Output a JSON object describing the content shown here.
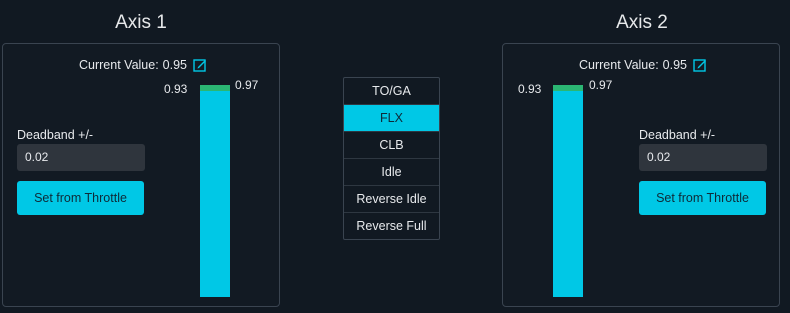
{
  "axis1": {
    "title": "Axis 1",
    "current_label": "Current Value:",
    "current_value": "0.95",
    "left_label": "0.93",
    "right_label": "0.97",
    "deadband_label": "Deadband +/-",
    "deadband_value": "0.02",
    "set_button": "Set from Throttle",
    "icon": "edit-icon"
  },
  "axis2": {
    "title": "Axis 2",
    "current_label": "Current Value:",
    "current_value": "0.95",
    "left_label": "0.93",
    "right_label": "0.97",
    "deadband_label": "Deadband +/-",
    "deadband_value": "0.02",
    "set_button": "Set from Throttle",
    "icon": "edit-icon"
  },
  "detents": {
    "items": [
      "TO/GA",
      "FLX",
      "CLB",
      "Idle",
      "Reverse Idle",
      "Reverse Full"
    ],
    "selected": "FLX"
  },
  "colors": {
    "accent": "#00c8e6",
    "range_marker": "#2bb673",
    "background": "#111922"
  }
}
